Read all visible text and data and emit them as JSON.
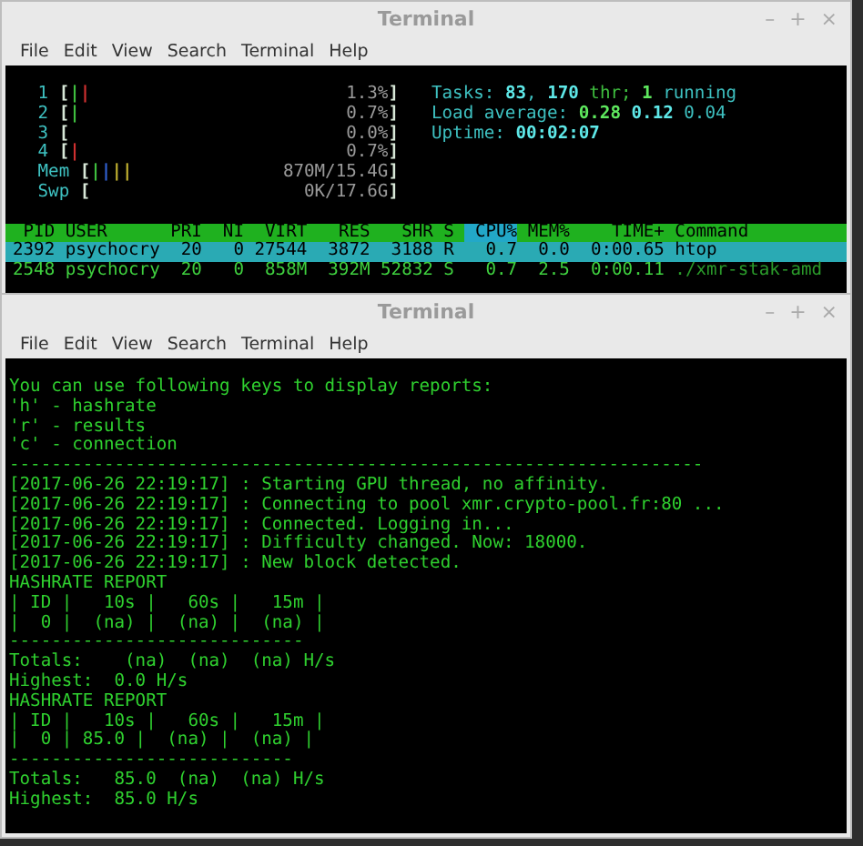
{
  "windows": [
    {
      "title": "Terminal",
      "menu": [
        "File",
        "Edit",
        "View",
        "Search",
        "Terminal",
        "Help"
      ],
      "controls": [
        "–",
        "+",
        "×"
      ],
      "htop": {
        "meters": [
          {
            "label": "1",
            "open": "[",
            "segments": [
              {
                "text": "|",
                "color": "#3fbf3f"
              },
              {
                "text": "|",
                "color": "#d03030"
              }
            ],
            "reading": "1.3%",
            "close": "]"
          },
          {
            "label": "2",
            "open": "[",
            "segments": [
              {
                "text": "|",
                "color": "#3fbf3f"
              }
            ],
            "reading": "0.7%",
            "close": "]"
          },
          {
            "label": "3",
            "open": "[",
            "reading": "0.0%",
            "close": "]"
          },
          {
            "label": "4",
            "open": "[",
            "segments": [
              {
                "text": "|",
                "color": "#d03030"
              }
            ],
            "reading": "0.7%",
            "close": "]"
          },
          {
            "label": "Mem",
            "open": "[",
            "segments": [
              {
                "text": "|",
                "color": "#3fbf3f"
              },
              {
                "text": "|",
                "color": "#3060d0"
              },
              {
                "text": "|",
                "color": "#c0b030"
              },
              {
                "text": "|",
                "color": "#c0b030"
              }
            ],
            "reading": "870M/15.4G",
            "close": "]"
          },
          {
            "label": "Swp",
            "open": "[",
            "reading": "0K/17.6G",
            "close": "]"
          }
        ],
        "stats": [
          [
            {
              "text": "Tasks: ",
              "color": "#3ec1c1",
              "bold": false
            },
            {
              "text": "83",
              "color": "#5ee8e8",
              "bold": true
            },
            {
              "text": ", ",
              "color": "#3ec1c1",
              "bold": false
            },
            {
              "text": "170",
              "color": "#5ee8e8",
              "bold": true
            },
            {
              "text": " thr; ",
              "color": "#3fbf3f",
              "bold": false
            },
            {
              "text": "1",
              "color": "#5ee85e",
              "bold": true
            },
            {
              "text": " running",
              "color": "#3ec1c1",
              "bold": false
            }
          ],
          [
            {
              "text": "Load average: ",
              "color": "#3ec1c1",
              "bold": false
            },
            {
              "text": "0.28 ",
              "color": "#5ee85e",
              "bold": true
            },
            {
              "text": "0.12 ",
              "color": "#5ee8e8",
              "bold": true
            },
            {
              "text": "0.04",
              "color": "#3ec1c1",
              "bold": false
            }
          ],
          [
            {
              "text": "Uptime: ",
              "color": "#3ec1c1",
              "bold": false
            },
            {
              "text": "00:02:07",
              "color": "#5ee8e8",
              "bold": true
            }
          ]
        ],
        "columns": [
          {
            "label": "PID",
            "sorted": false
          },
          {
            "label": "USER",
            "sorted": false
          },
          {
            "label": "PRI",
            "sorted": false
          },
          {
            "label": "NI",
            "sorted": false
          },
          {
            "label": "VIRT",
            "sorted": false
          },
          {
            "label": "RES",
            "sorted": false
          },
          {
            "label": "SHR",
            "sorted": false
          },
          {
            "label": "S",
            "sorted": false
          },
          {
            "label": "CPU%",
            "sorted": true
          },
          {
            "label": "MEM%",
            "sorted": false
          },
          {
            "label": "TIME+",
            "sorted": false
          },
          {
            "label": "Command",
            "sorted": false
          }
        ],
        "rows": [
          {
            "selected": true,
            "cells": [
              "2392",
              "psychocry",
              "20",
              "0",
              "27544",
              "3872",
              "3188",
              "R",
              "0.7",
              "0.0",
              "0:00.65",
              "htop"
            ]
          },
          {
            "selected": false,
            "cells": [
              "2548",
              "psychocry",
              "20",
              "0",
              "858M",
              "392M",
              "52832",
              "S",
              "0.7",
              "2.5",
              "0:00.11",
              "./xmr-stak-amd"
            ]
          }
        ]
      }
    },
    {
      "title": "Terminal",
      "menu": [
        "File",
        "Edit",
        "View",
        "Search",
        "Terminal",
        "Help"
      ],
      "controls": [
        "–",
        "+",
        "×"
      ],
      "lines": [
        "You can use following keys to display reports:",
        "'h' - hashrate",
        "'r' - results",
        "'c' - connection",
        "------------------------------------------------------------------",
        "[2017-06-26 22:19:17] : Starting GPU thread, no affinity.",
        "[2017-06-26 22:19:17] : Connecting to pool xmr.crypto-pool.fr:80 ...",
        "[2017-06-26 22:19:17] : Connected. Logging in...",
        "[2017-06-26 22:19:17] : Difficulty changed. Now: 18000.",
        "[2017-06-26 22:19:17] : New block detected.",
        "HASHRATE REPORT",
        "| ID |   10s |   60s |   15m |",
        "|  0 |  (na) |  (na) |  (na) |",
        "----------------------------",
        "Totals:    (na)  (na)  (na) H/s",
        "Highest:  0.0 H/s",
        "HASHRATE REPORT",
        "| ID |   10s |   60s |   15m |",
        "|  0 | 85.0 |  (na) |  (na) |",
        "---------------------------",
        "Totals:   85.0  (na)  (na) H/s",
        "Highest:  85.0 H/s"
      ]
    }
  ]
}
